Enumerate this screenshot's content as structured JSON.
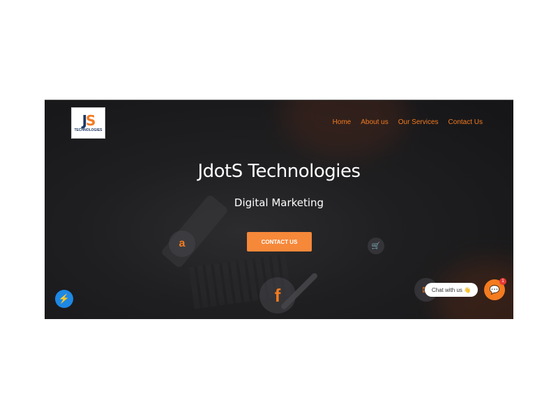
{
  "logo": {
    "mark_j": "J",
    "mark_s": "S",
    "name": "TECHNOLOGIES"
  },
  "nav": {
    "items": [
      {
        "label": "Home"
      },
      {
        "label": "About us"
      },
      {
        "label": "Our Services"
      },
      {
        "label": "Contact Us"
      }
    ]
  },
  "hero": {
    "title": "JdotS Technologies",
    "subtitle": "Digital Marketing",
    "cta_label": "CONTACT US"
  },
  "icons": {
    "amazon": "a",
    "cart": "🛒",
    "facebook": "f",
    "small": "✉",
    "messenger": "⚡"
  },
  "chat": {
    "bubble_text": "Chat with us 👋",
    "badge_count": "1",
    "button_icon": "💬"
  },
  "colors": {
    "accent": "#f47b20",
    "hero_bg": "#1f1f21",
    "messenger": "#1e88e5",
    "badge": "#e53935"
  }
}
